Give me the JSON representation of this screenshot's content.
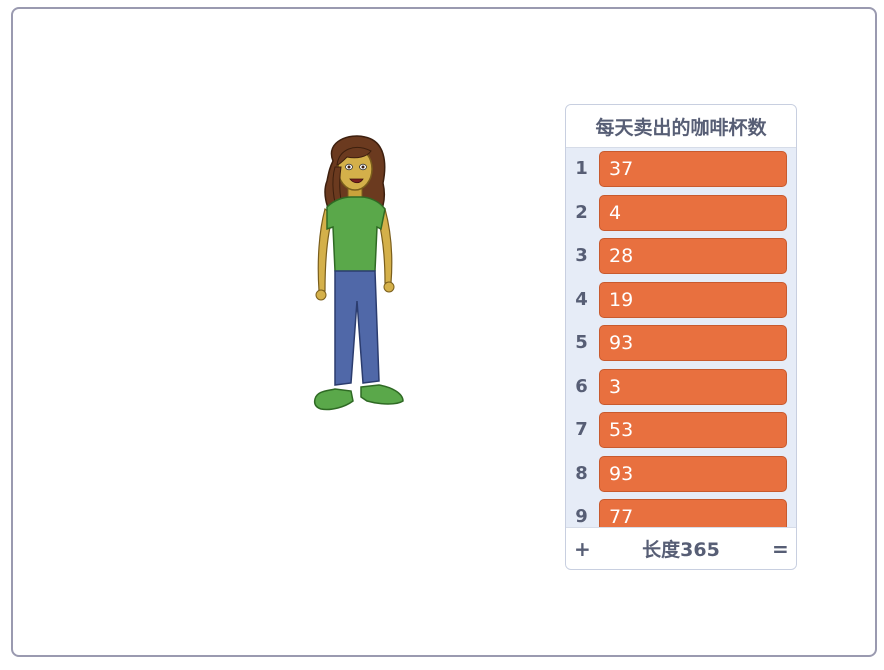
{
  "list": {
    "title": "每天卖出的咖啡杯数",
    "items": [
      {
        "index": "1",
        "value": "37"
      },
      {
        "index": "2",
        "value": "4"
      },
      {
        "index": "3",
        "value": "28"
      },
      {
        "index": "4",
        "value": "19"
      },
      {
        "index": "5",
        "value": "93"
      },
      {
        "index": "6",
        "value": "3"
      },
      {
        "index": "7",
        "value": "53"
      },
      {
        "index": "8",
        "value": "93"
      },
      {
        "index": "9",
        "value": "77"
      }
    ],
    "add_label": "+",
    "length_label": "长度365",
    "resize_label": "="
  },
  "sprite": {
    "name": "girl-sprite"
  },
  "colors": {
    "item_fill": "#e8703f",
    "text": "#575e75",
    "stage_border": "#9a9ab0"
  }
}
